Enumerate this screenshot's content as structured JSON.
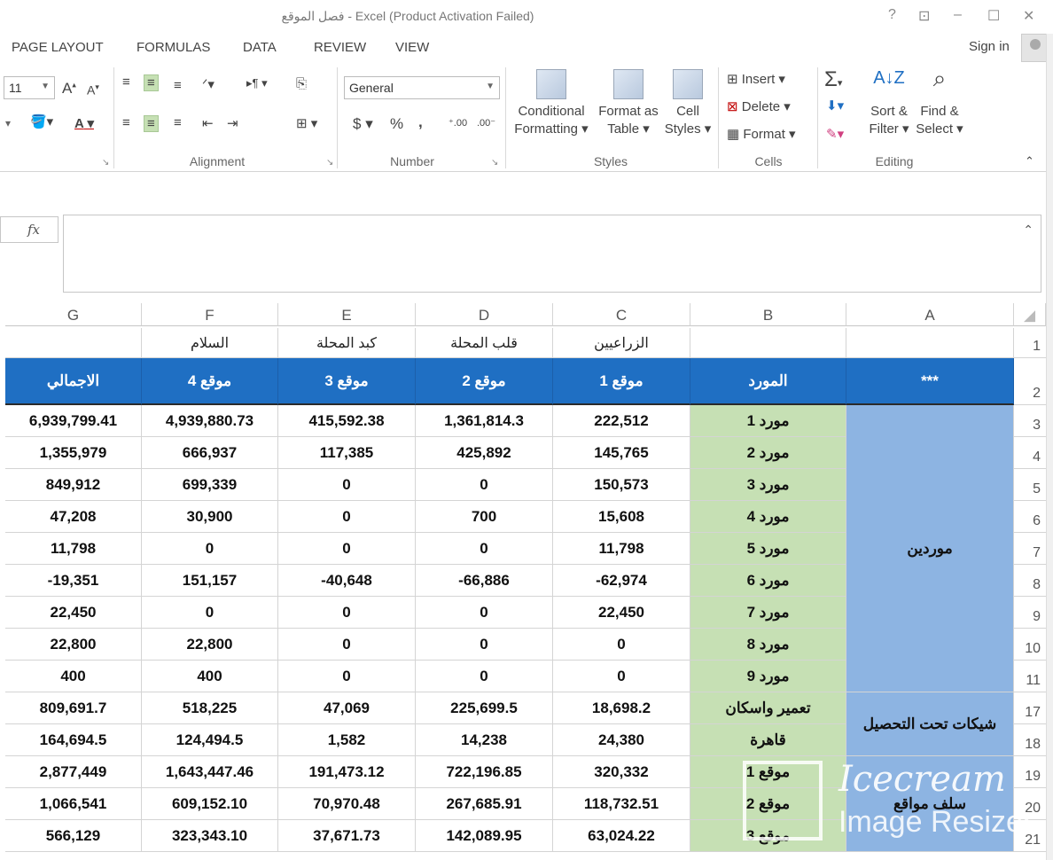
{
  "window": {
    "title": "فصل الموقع - Excel (Product Activation Failed)",
    "help": "?",
    "restore_ribbon": "⊡",
    "minimize": "–",
    "maximize": "☐",
    "close": "✕"
  },
  "ribbon_tabs": [
    "PAGE LAYOUT",
    "FORMULAS",
    "DATA",
    "REVIEW",
    "VIEW"
  ],
  "sign_in": "Sign in",
  "font": {
    "size": "11",
    "grow": "A",
    "shrink": "A",
    "font_color": "A"
  },
  "groups": {
    "alignment": "Alignment",
    "number": "Number",
    "styles": "Styles",
    "cells": "Cells",
    "editing": "Editing"
  },
  "number_format": "General",
  "number_buttons": {
    "currency": "$",
    "percent": "%",
    "comma": ","
  },
  "styles_buttons": [
    {
      "line1": "Conditional",
      "line2": "Formatting"
    },
    {
      "line1": "Format as",
      "line2": "Table"
    },
    {
      "line1": "Cell",
      "line2": "Styles"
    }
  ],
  "cells_buttons": [
    "Insert",
    "Delete",
    "Format"
  ],
  "editing_buttons": [
    {
      "line1": "Sort &",
      "line2": "Filter"
    },
    {
      "line1": "Find &",
      "line2": "Select"
    }
  ],
  "formula_bar": {
    "fx": "fx",
    "value": ""
  },
  "columns": [
    "G",
    "F",
    "E",
    "D",
    "C",
    "B",
    "A"
  ],
  "row1_names": {
    "F": "السلام",
    "E": "كبد المحلة",
    "D": "قلب المحلة",
    "C": "الزراعيين"
  },
  "header_row": {
    "G": "الاجمالي",
    "F": "موقع 4",
    "E": "موقع 3",
    "D": "موقع 2",
    "C": "موقع 1",
    "B": "المورد",
    "A": "***"
  },
  "row_numbers": [
    "1",
    "2",
    "3",
    "4",
    "5",
    "6",
    "7",
    "8",
    "9",
    "10",
    "11",
    "17",
    "18",
    "19",
    "20",
    "21"
  ],
  "rows": [
    {
      "G": "6,939,799.41",
      "F": "4,939,880.73",
      "E": "415,592.38",
      "D": "1,361,814.3",
      "C": "222,512",
      "B": "مورد 1"
    },
    {
      "G": "1,355,979",
      "F": "666,937",
      "E": "117,385",
      "D": "425,892",
      "C": "145,765",
      "B": "مورد 2"
    },
    {
      "G": "849,912",
      "F": "699,339",
      "E": "0",
      "D": "0",
      "C": "150,573",
      "B": "مورد 3"
    },
    {
      "G": "47,208",
      "F": "30,900",
      "E": "0",
      "D": "700",
      "C": "15,608",
      "B": "مورد 4"
    },
    {
      "G": "11,798",
      "F": "0",
      "E": "0",
      "D": "0",
      "C": "11,798",
      "B": "مورد 5"
    },
    {
      "G": "-19,351",
      "F": "151,157",
      "E": "-40,648",
      "D": "-66,886",
      "C": "-62,974",
      "B": "مورد 6"
    },
    {
      "G": "22,450",
      "F": "0",
      "E": "0",
      "D": "0",
      "C": "22,450",
      "B": "مورد 7"
    },
    {
      "G": "22,800",
      "F": "22,800",
      "E": "0",
      "D": "0",
      "C": "0",
      "B": "مورد 8"
    },
    {
      "G": "400",
      "F": "400",
      "E": "0",
      "D": "0",
      "C": "0",
      "B": "مورد 9"
    },
    {
      "G": "809,691.7",
      "F": "518,225",
      "E": "47,069",
      "D": "225,699.5",
      "C": "18,698.2",
      "B": "تعمير واسكان"
    },
    {
      "G": "164,694.5",
      "F": "124,494.5",
      "E": "1,582",
      "D": "14,238",
      "C": "24,380",
      "B": "قاهرة"
    },
    {
      "G": "2,877,449",
      "F": "1,643,447.46",
      "E": "191,473.12",
      "D": "722,196.85",
      "C": "320,332",
      "B": "موقع 1"
    },
    {
      "G": "1,066,541",
      "F": "609,152.10",
      "E": "70,970.48",
      "D": "267,685.91",
      "C": "118,732.51",
      "B": "موقع 2"
    },
    {
      "G": "566,129",
      "F": "323,343.10",
      "E": "37,671.73",
      "D": "142,089.95",
      "C": "63,024.22",
      "B": "موقع 3"
    }
  ],
  "groups_col_a": {
    "suppliers": "موردين",
    "checks": "شيكات تحت التحصيل",
    "advances": "سلف مواقع"
  },
  "watermark": {
    "title": "Icecream",
    "subtitle": "Image Resizer"
  },
  "colors": {
    "header_blue": "#1f6fc3",
    "supplier_green": "#c6e0b4",
    "group_blue": "#8db4e2"
  }
}
